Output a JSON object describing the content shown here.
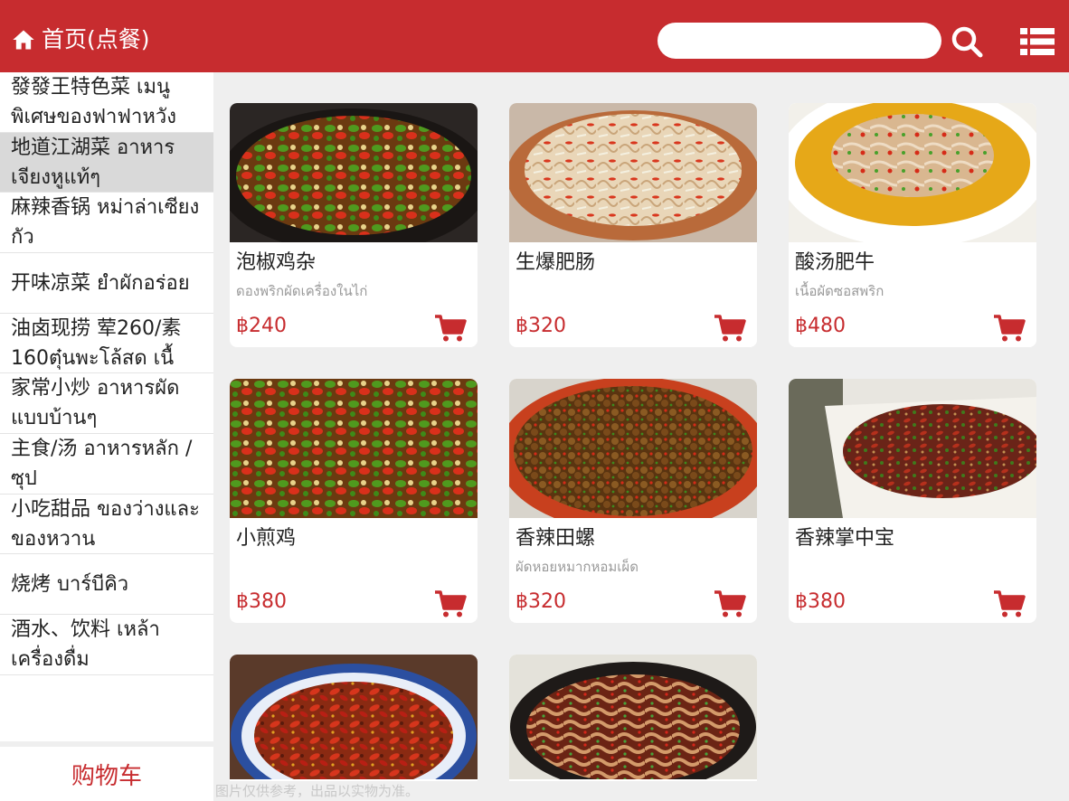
{
  "header": {
    "title": "首页(点餐)",
    "home_icon": "home-icon",
    "search_value": "",
    "search_icon": "search-icon",
    "menu_icon": "list-menu-icon",
    "brand_color": "#c72c2f"
  },
  "sidebar": {
    "categories": [
      {
        "label": "發發王特色菜 เมนูพิเศษของฟาฟาหวัง",
        "active": false
      },
      {
        "label": "地道江湖菜 อาหารเจียงหูแท้ๆ",
        "active": true
      },
      {
        "label": "麻辣香锅 หม่าล่าเซียงกัว",
        "active": false
      },
      {
        "label": "开味凉菜 ยำผักอร่อย",
        "active": false
      },
      {
        "label": "油卤现捞 荤260/素160ตุ๋นพะโล้สด เนื้",
        "active": false
      },
      {
        "label": "家常小炒 อาหารผัดแบบบ้านๆ",
        "active": false
      },
      {
        "label": "主食/汤 อาหารหลัก / ซุป",
        "active": false
      },
      {
        "label": "小吃甜品 ของว่างและของหวาน",
        "active": false
      },
      {
        "label": "烧烤 บาร์บีคิว",
        "active": false
      },
      {
        "label": "酒水、饮料 เหล้า เครื่องดื่ม",
        "active": false
      }
    ],
    "cart_label": "购物车"
  },
  "products": [
    {
      "name": "泡椒鸡杂",
      "thai": "ดองพริกผัดเครื่องในไก่",
      "price": "฿240",
      "cart_icon": "add-to-cart-icon"
    },
    {
      "name": "生爆肥肠",
      "thai": "",
      "price": "฿320",
      "cart_icon": "add-to-cart-icon"
    },
    {
      "name": "酸汤肥牛",
      "thai": "เนื้อผัดซอสพริก",
      "price": "฿480",
      "cart_icon": "add-to-cart-icon"
    },
    {
      "name": "小煎鸡",
      "thai": "",
      "price": "฿380",
      "cart_icon": "add-to-cart-icon"
    },
    {
      "name": "香辣田螺",
      "thai": "ผัดหอยหมากหอมเผ็ด",
      "price": "฿320",
      "cart_icon": "add-to-cart-icon"
    },
    {
      "name": "香辣掌中宝",
      "thai": "",
      "price": "฿380",
      "cart_icon": "add-to-cart-icon"
    }
  ],
  "footnote": "图片仅供参考，出品以实物为准。"
}
